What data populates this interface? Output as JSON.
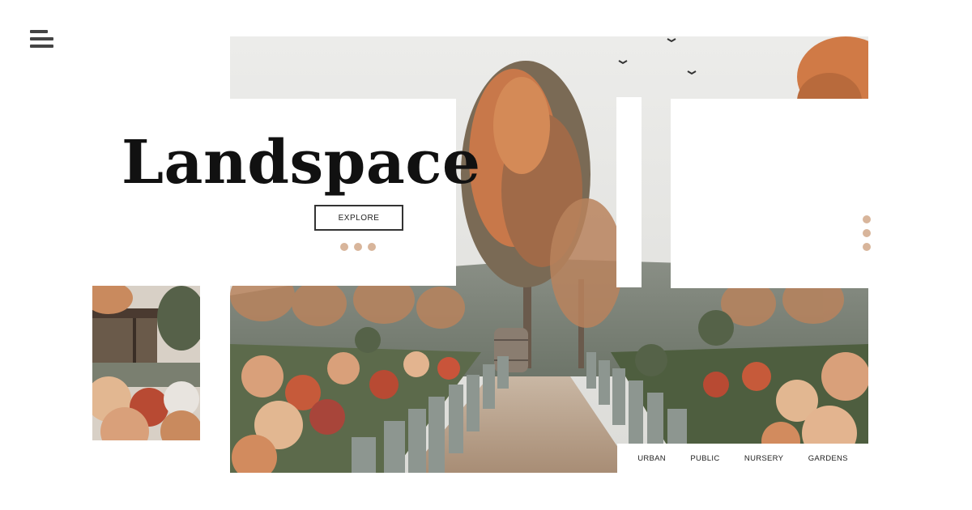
{
  "hero": {
    "title": "Landspace",
    "cta_label": "EXPLORE",
    "slide_dots_count": 3,
    "side_dots_count": 3
  },
  "categories": [
    {
      "label": "URBAN"
    },
    {
      "label": "PUBLIC"
    },
    {
      "label": "NURSERY"
    },
    {
      "label": "GARDENS"
    }
  ],
  "icons": {
    "menu": "hamburger-menu-icon"
  },
  "colors": {
    "accent_dot": "#d8b59b",
    "title_text": "#111111",
    "menu_icon": "#444444",
    "background": "#ffffff"
  }
}
